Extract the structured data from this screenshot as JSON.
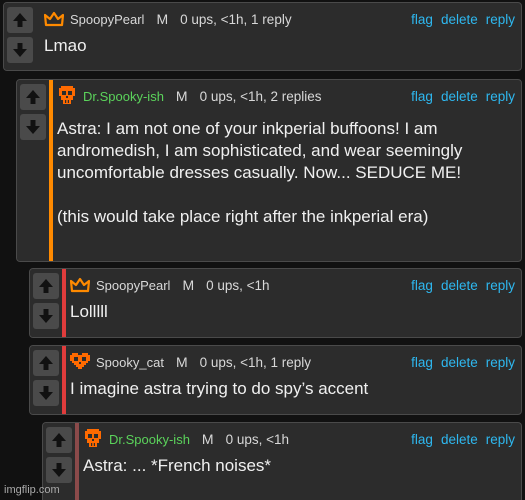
{
  "colors": {
    "accent_orange": "#ff8a00",
    "accent_red": "#e03c3c",
    "accent_muted": "#8b4a4a",
    "link": "#2eb8f0",
    "green_user": "#5bd35b"
  },
  "actions": {
    "flag": "flag",
    "delete": "delete",
    "reply": "reply"
  },
  "comments": [
    {
      "username": "SpoopyPearl",
      "badge": "M",
      "meta": "0 ups, <1h, 1 reply",
      "avatar": "crown-icon",
      "text": "Lmao"
    },
    {
      "username": "Dr.Spooky-ish",
      "badge": "M",
      "meta": "0 ups, <1h, 2 replies",
      "avatar": "orange-skull-icon",
      "text": "Astra: I am not one of your inkperial buffoons! I am andromedish, I am sophisticated, and wear seemingly uncomfortable dresses casually. Now... SEDUCE ME!\n\n(this would take place right after the inkperial era)"
    },
    {
      "username": "SpoopyPearl",
      "badge": "M",
      "meta": "0 ups, <1h",
      "avatar": "crown-icon",
      "text": "Lolllll"
    },
    {
      "username": "Spooky_cat",
      "badge": "M",
      "meta": "0 ups, <1h, 1 reply",
      "avatar": "orange-heart-skull-icon",
      "text": "I imagine astra trying to do spy’s accent"
    },
    {
      "username": "Dr.Spooky-ish",
      "badge": "M",
      "meta": "0 ups, <1h",
      "avatar": "orange-skull-icon",
      "text": "Astra: ... *French noises*"
    }
  ],
  "footer": {
    "watermark": "imgflip.com"
  }
}
